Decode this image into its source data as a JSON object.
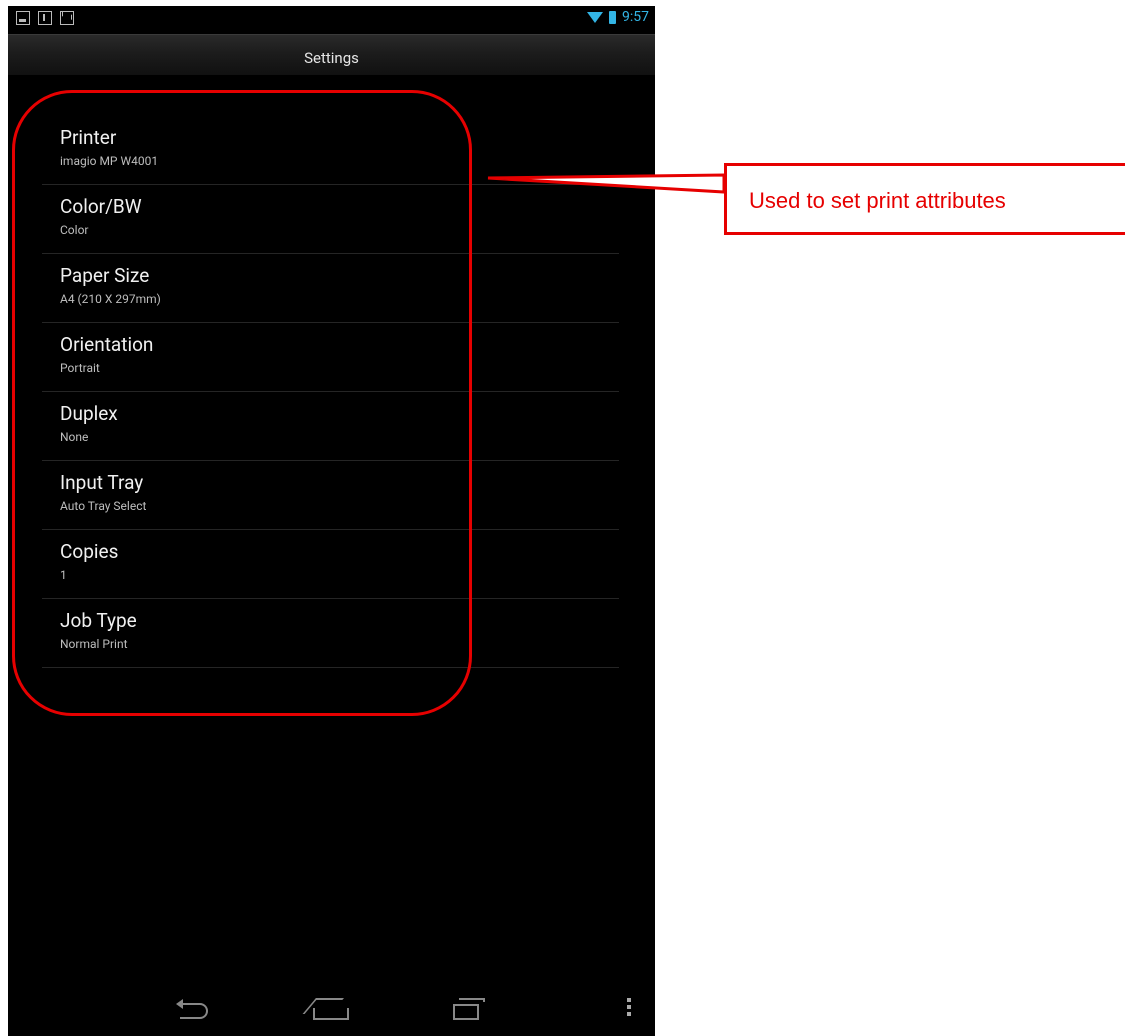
{
  "status_bar": {
    "time": "9:57"
  },
  "title_bar": {
    "title": "Settings"
  },
  "settings": [
    {
      "title": "Printer",
      "value": "imagio MP W4001"
    },
    {
      "title": "Color/BW",
      "value": "Color"
    },
    {
      "title": "Paper Size",
      "value": "A4 (210 X 297mm)"
    },
    {
      "title": "Orientation",
      "value": "Portrait"
    },
    {
      "title": "Duplex",
      "value": "None"
    },
    {
      "title": "Input Tray",
      "value": "Auto Tray Select"
    },
    {
      "title": "Copies",
      "value": "1"
    },
    {
      "title": "Job Type",
      "value": "Normal Print"
    }
  ],
  "annotation": {
    "label": "Used to set print attributes",
    "color": "#e60000"
  }
}
